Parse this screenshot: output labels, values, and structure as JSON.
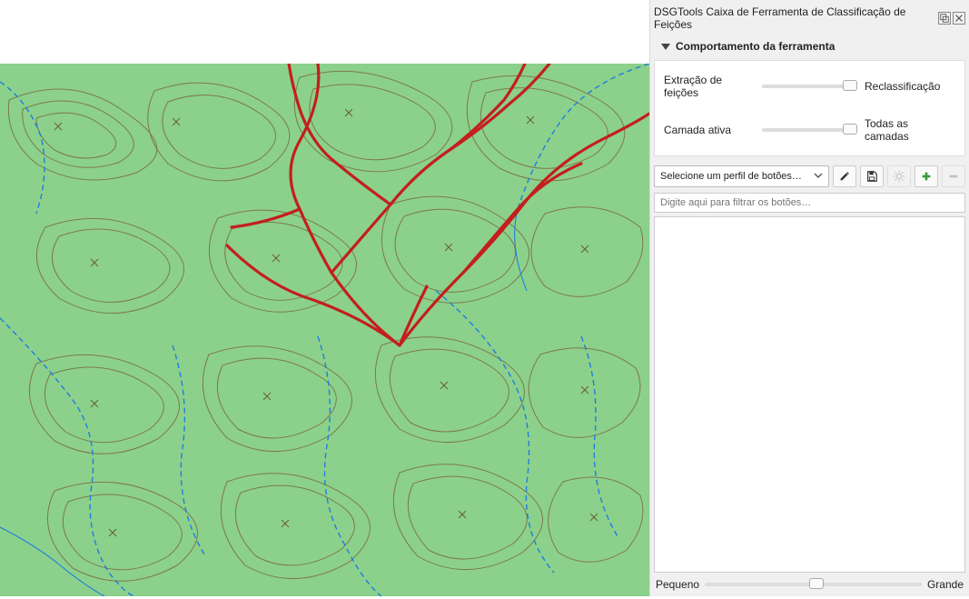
{
  "panel": {
    "title": "DSGTools Caixa de Ferramenta de Classificação de Feições"
  },
  "section": {
    "title": "Comportamento da ferramenta"
  },
  "controls": {
    "leftLabel1": "Extração de feições",
    "rightLabel1": "Reclassificação",
    "leftLabel2": "Camada ativa",
    "rightLabel2": "Todas as camadas"
  },
  "toolbar": {
    "selectPlaceholder": "Selecione um perfil de botões…"
  },
  "filter": {
    "placeholder": "Digite aqui para filtrar os botões…"
  },
  "bottom": {
    "small": "Pequeno",
    "large": "Grande"
  }
}
